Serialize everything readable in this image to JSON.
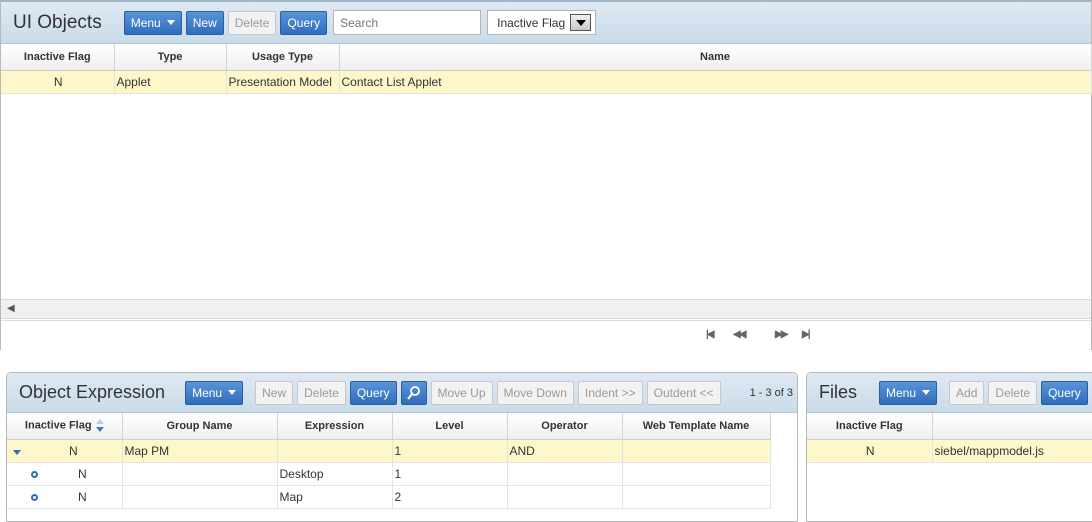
{
  "ui_objects": {
    "title": "UI Objects",
    "menu_label": "Menu",
    "new_label": "New",
    "delete_label": "Delete",
    "query_label": "Query",
    "search_placeholder": "Search",
    "filter_field": "Inactive Flag",
    "columns": [
      "Inactive Flag",
      "Type",
      "Usage Type",
      "Name"
    ],
    "rows": [
      {
        "inactive_flag": "N",
        "type": "Applet",
        "usage_type": "Presentation Model",
        "name": "Contact List Applet"
      }
    ]
  },
  "object_expression": {
    "title": "Object Expression",
    "menu_label": "Menu",
    "new_label": "New",
    "delete_label": "Delete",
    "query_label": "Query",
    "move_up_label": "Move Up",
    "move_down_label": "Move Down",
    "indent_label": "Indent >>",
    "outdent_label": "Outdent <<",
    "record_count": "1 - 3 of 3",
    "columns": [
      "Inactive Flag",
      "Group Name",
      "Expression",
      "Level",
      "Operator",
      "Web Template Name"
    ],
    "rows": [
      {
        "inactive_flag": "N",
        "group_name": "Map PM",
        "expression": "",
        "level": "1",
        "operator": "AND",
        "web_template_name": ""
      },
      {
        "inactive_flag": "N",
        "group_name": "",
        "expression": "Desktop",
        "level": "1",
        "operator": "",
        "web_template_name": ""
      },
      {
        "inactive_flag": "N",
        "group_name": "",
        "expression": "Map",
        "level": "2",
        "operator": "",
        "web_template_name": ""
      }
    ]
  },
  "files": {
    "title": "Files",
    "menu_label": "Menu",
    "add_label": "Add",
    "delete_label": "Delete",
    "query_label": "Query",
    "columns": [
      "Inactive Flag",
      ""
    ],
    "rows": [
      {
        "inactive_flag": "N",
        "file": "siebel/mappmodel.js"
      }
    ]
  },
  "icons": {
    "menu_caret": "chevron-down-icon",
    "select_arrow": "dropdown-arrow-icon",
    "scroll_left": "scroll-left-icon",
    "pager_first": "first-page-icon",
    "pager_prev": "previous-page-icon",
    "pager_next": "next-page-icon",
    "pager_last": "last-page-icon",
    "sort": "sort-icon",
    "magnify": "magnify-icon",
    "expand": "expand-arrow-icon",
    "bullet": "tree-bullet-icon"
  },
  "colors": {
    "header_bg": "#c9dbea",
    "button_blue": "#2f6dbd",
    "selected_row": "#fdf7c9"
  }
}
